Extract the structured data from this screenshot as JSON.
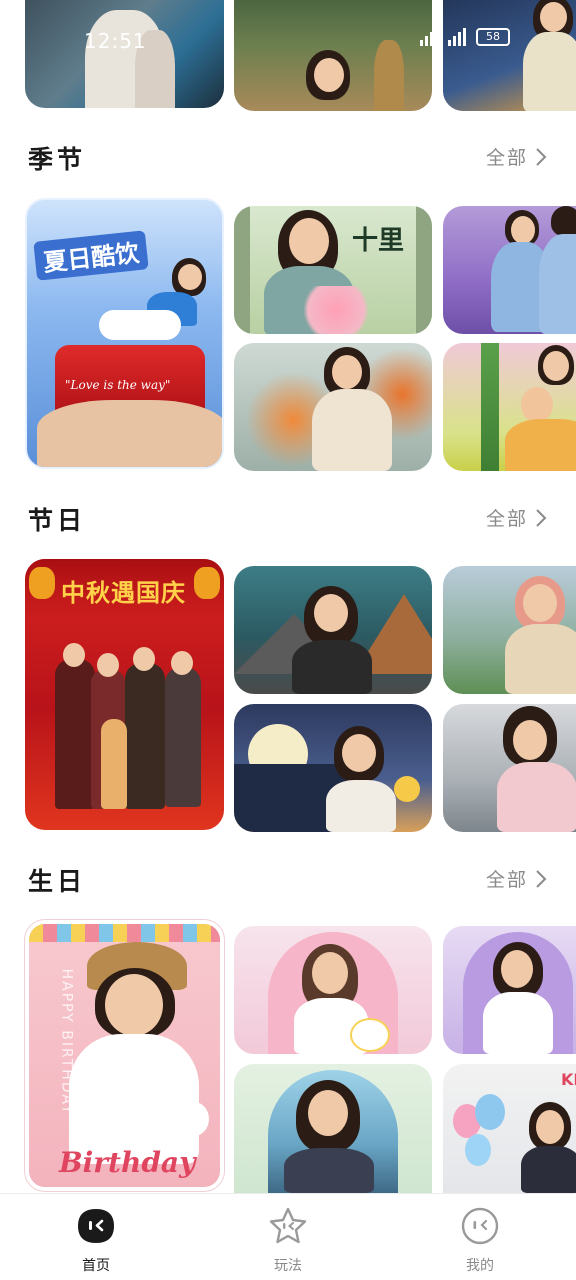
{
  "status": {
    "time": "12:51",
    "battery": "58"
  },
  "sections": [
    {
      "title": "季节",
      "see_all": "全部"
    },
    {
      "title": "节日",
      "see_all": "全部"
    },
    {
      "title": "生日",
      "see_all": "全部"
    }
  ],
  "cards": {
    "summer_title": "夏日酷饮",
    "summer_can": "\"Love is the way\"",
    "autumn_title": "十里",
    "holiday_title": "中秋遇国庆",
    "birthday_text": "Birthday",
    "birthday_side": "HAPPY BIRTHDAY",
    "kh": "KH"
  },
  "nav": [
    {
      "label": "首页",
      "icon": "home-face-icon",
      "active": true
    },
    {
      "label": "玩法",
      "icon": "star-icon",
      "active": false
    },
    {
      "label": "我的",
      "icon": "face-icon",
      "active": false
    }
  ],
  "colors": {
    "text": "#1a1a1a",
    "muted": "#8a8a8a",
    "festival_red": "#c8161d"
  }
}
